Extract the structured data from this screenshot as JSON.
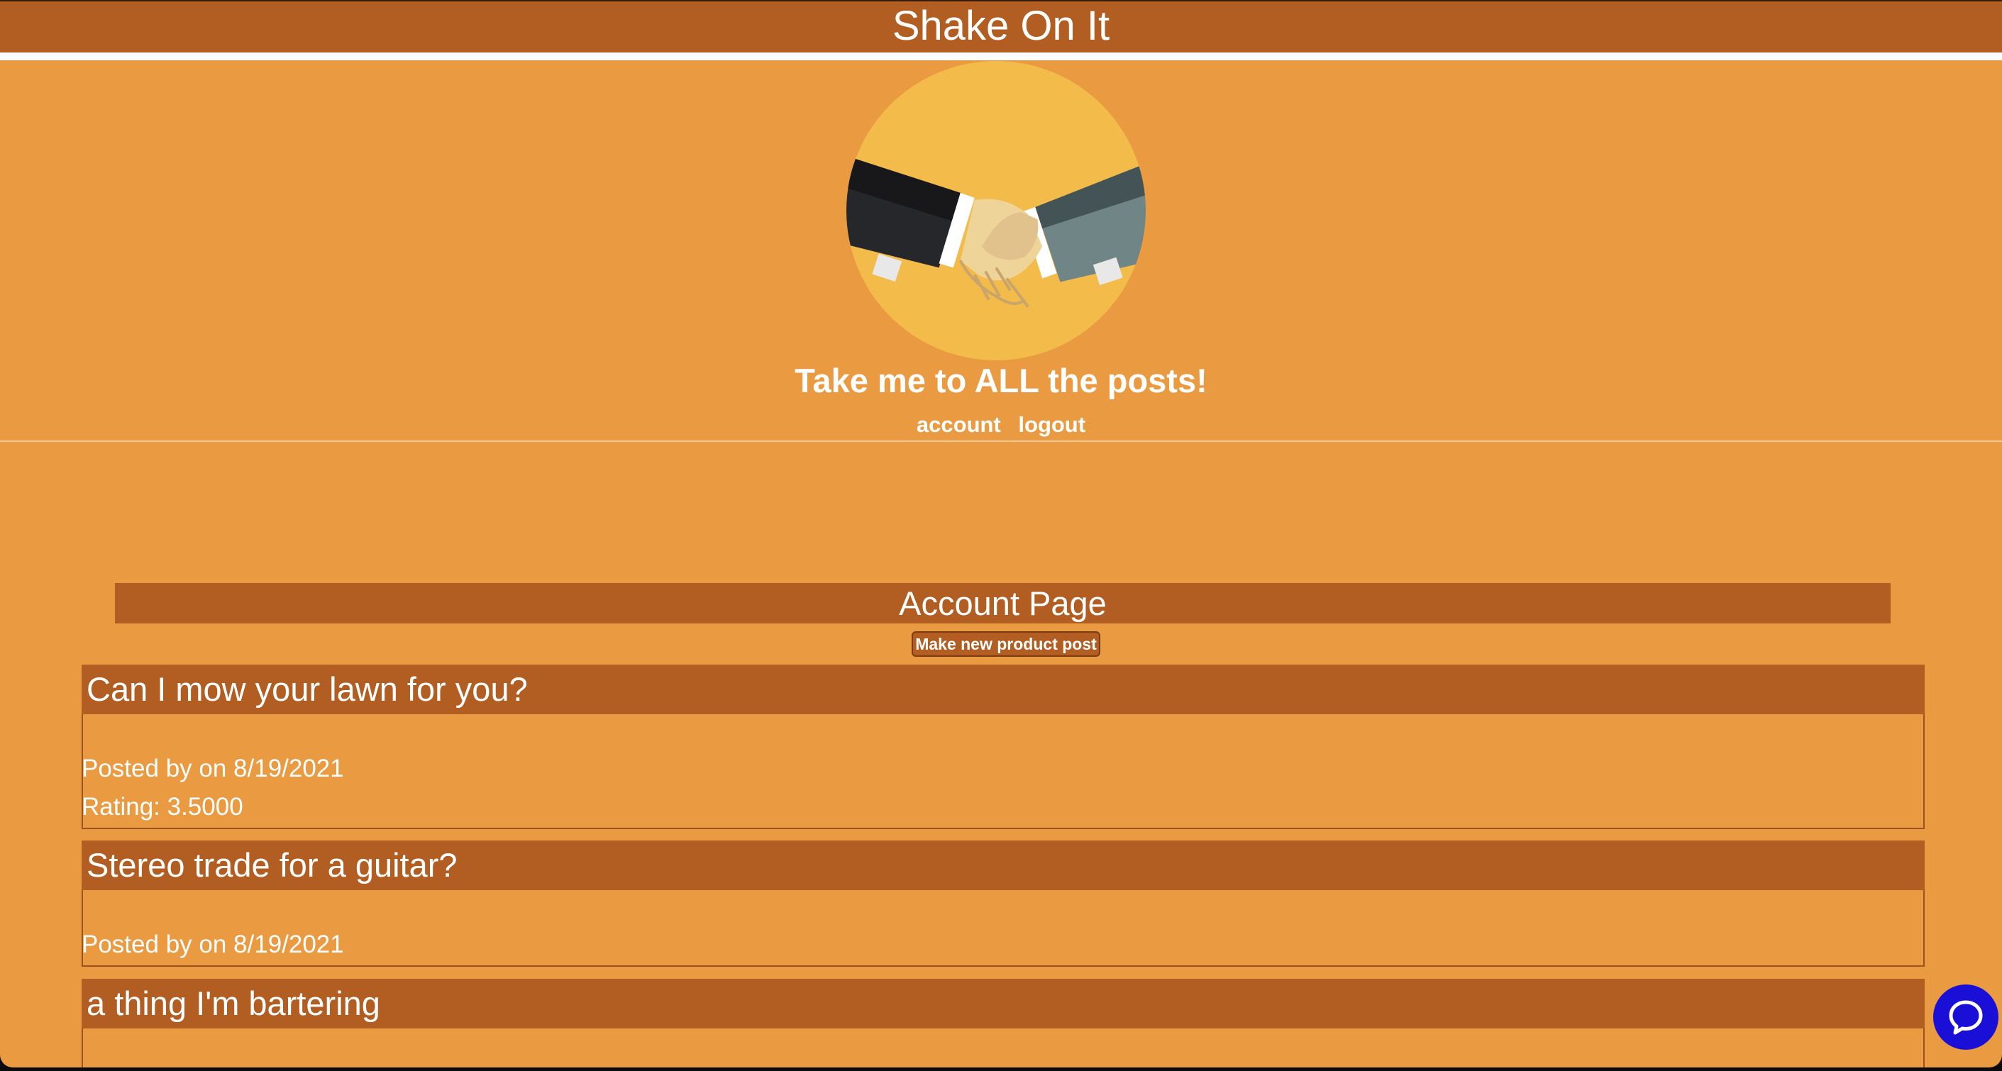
{
  "site": {
    "title": "Shake On It"
  },
  "nav": {
    "all_posts_label": "Take me to ALL the posts!",
    "account_label": "account",
    "logout_label": "logout"
  },
  "page": {
    "title": "Account Page",
    "new_post_button": "Make new product post"
  },
  "posts": [
    {
      "title": "Can I mow your lawn for you?",
      "posted_by": "Posted by on 8/19/2021",
      "rating": "Rating: 3.5000"
    },
    {
      "title": "Stereo trade for a guitar?",
      "posted_by": "Posted by on 8/19/2021"
    },
    {
      "title": "a thing I'm bartering"
    }
  ],
  "icons": {
    "logo": "handshake-logo-icon",
    "chat": "chat-bubble-icon"
  },
  "colors": {
    "page_background": "#ea9a40",
    "header_background": "#b25e22",
    "logo_circle": "#f3bb4a",
    "chat_button": "#1a0fd6",
    "text": "#ffffff"
  }
}
